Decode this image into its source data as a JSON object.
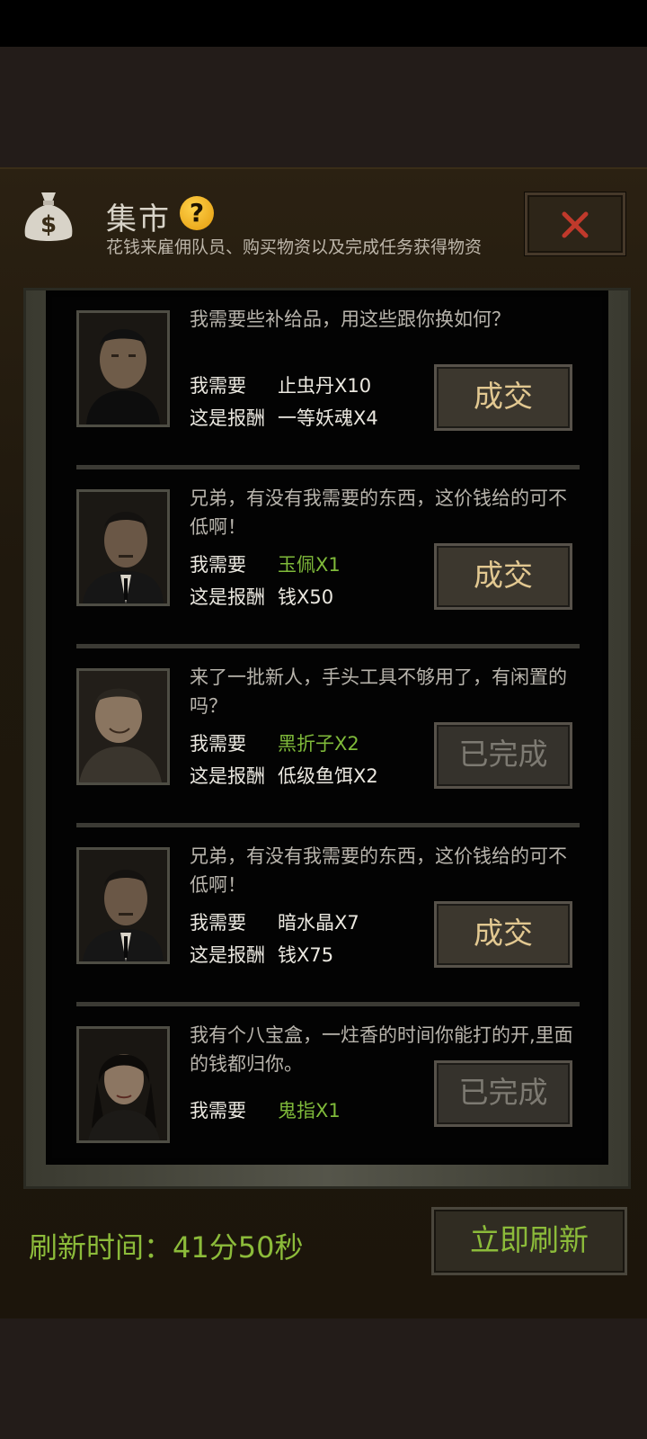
{
  "header": {
    "title": "集市",
    "help_icon": "?",
    "subtitle": "花钱来雇佣队员、购买物资以及完成任务获得物资",
    "bag_icon": "money-bag-icon",
    "close_icon": "close-icon",
    "accent_color": "#c0392b"
  },
  "trades": [
    {
      "dialogue": "我需要些补给品，用这些跟你换如何？",
      "need_label": "我需要",
      "need_item": "止虫丹X10",
      "need_green": false,
      "reward_label": "这是报酬",
      "reward_item": "一等妖魂X4",
      "button": "成交",
      "done": false
    },
    {
      "dialogue": "兄弟，有没有我需要的东西，这价钱给的可不低啊！",
      "need_label": "我需要",
      "need_item": "玉佩X1",
      "need_green": true,
      "reward_label": "这是报酬",
      "reward_item": "钱X50",
      "button": "成交",
      "done": false
    },
    {
      "dialogue": "来了一批新人，手头工具不够用了，有闲置的吗？",
      "need_label": "我需要",
      "need_item": "黑折子X2",
      "need_green": true,
      "reward_label": "这是报酬",
      "reward_item": "低级鱼饵X2",
      "button": "已完成",
      "done": true
    },
    {
      "dialogue": "兄弟，有没有我需要的东西，这价钱给的可不低啊！",
      "need_label": "我需要",
      "need_item": "暗水晶X7",
      "need_green": false,
      "reward_label": "这是报酬",
      "reward_item": "钱X75",
      "button": "成交",
      "done": false
    },
    {
      "dialogue": "我有个八宝盒，一炷香的时间你能打的开,里面的钱都归你。",
      "need_label": "我需要",
      "need_item": "鬼指X1",
      "need_green": true,
      "reward_label": "",
      "reward_item": "",
      "button": "已完成",
      "done": true
    }
  ],
  "footer": {
    "refresh_time": "刷新时间：41分50秒",
    "refresh_button": "立即刷新"
  },
  "colors": {
    "green_text": "#8cbb3a",
    "gold_text": "#e2c891"
  }
}
